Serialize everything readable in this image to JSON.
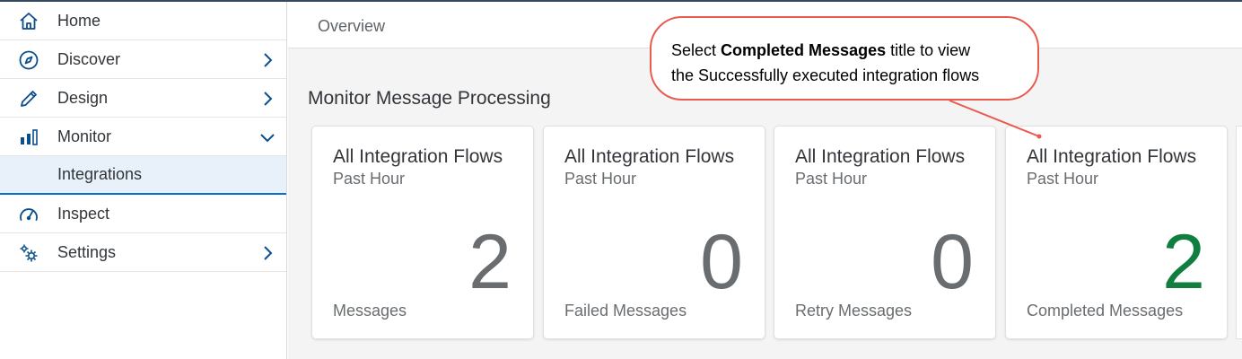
{
  "sidebar": {
    "items": [
      {
        "label": "Home",
        "icon": "home-icon"
      },
      {
        "label": "Discover",
        "icon": "compass-icon",
        "chevron": "right"
      },
      {
        "label": "Design",
        "icon": "pencil-icon",
        "chevron": "right"
      },
      {
        "label": "Monitor",
        "icon": "bar-chart-icon",
        "chevron": "down"
      },
      {
        "label": "Integrations",
        "selected": true
      },
      {
        "label": "Inspect",
        "icon": "gauge-icon"
      },
      {
        "label": "Settings",
        "icon": "gears-icon",
        "chevron": "right"
      }
    ]
  },
  "main": {
    "breadcrumb": "Overview",
    "section_title": "Monitor Message Processing",
    "tiles": [
      {
        "title": "All Integration Flows",
        "subtitle": "Past Hour",
        "value": "2",
        "footer": "Messages",
        "value_color": "#6a6d70"
      },
      {
        "title": "All Integration Flows",
        "subtitle": "Past Hour",
        "value": "0",
        "footer": "Failed Messages",
        "value_color": "#6a6d70"
      },
      {
        "title": "All Integration Flows",
        "subtitle": "Past Hour",
        "value": "0",
        "footer": "Retry Messages",
        "value_color": "#6a6d70"
      },
      {
        "title": "All Integration Flows",
        "subtitle": "Past Hour",
        "value": "2",
        "footer": "Completed Messages",
        "value_color": "#107e3e"
      }
    ]
  },
  "callout": {
    "prefix": "Select ",
    "bold": "Completed Messages",
    "suffix": " title to view",
    "line2": "the Successfully executed integration flows",
    "border_color": "#e95b50"
  },
  "colors": {
    "accent": "#0a6ed1",
    "icon_blue": "#0a4e8c",
    "positive": "#107e3e"
  }
}
